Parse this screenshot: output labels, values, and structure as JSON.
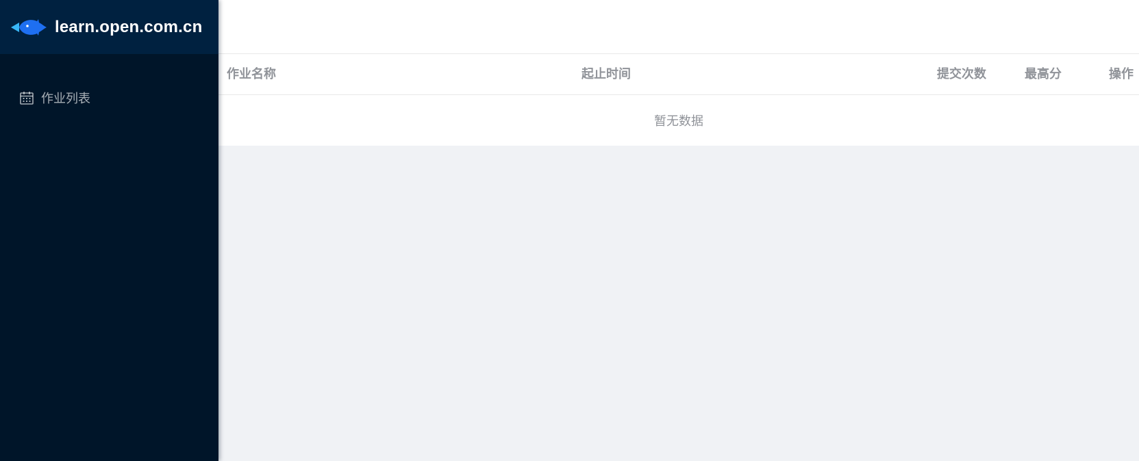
{
  "brand": {
    "title": "learn.open.com.cn",
    "logo_icon": "fish-logo-icon",
    "colors": {
      "sidebar_bg": "#001529",
      "brand_bg": "#002140",
      "logo_blue": "#1e6ff1",
      "logo_light": "#38b6f5"
    }
  },
  "sidebar": {
    "items": [
      {
        "label": "作业列表",
        "icon": "calendar-icon"
      }
    ]
  },
  "table": {
    "columns": [
      "作业名称",
      "起止时间",
      "提交次数",
      "最高分",
      "操作"
    ],
    "rows": [],
    "empty_text": "暂无数据"
  }
}
